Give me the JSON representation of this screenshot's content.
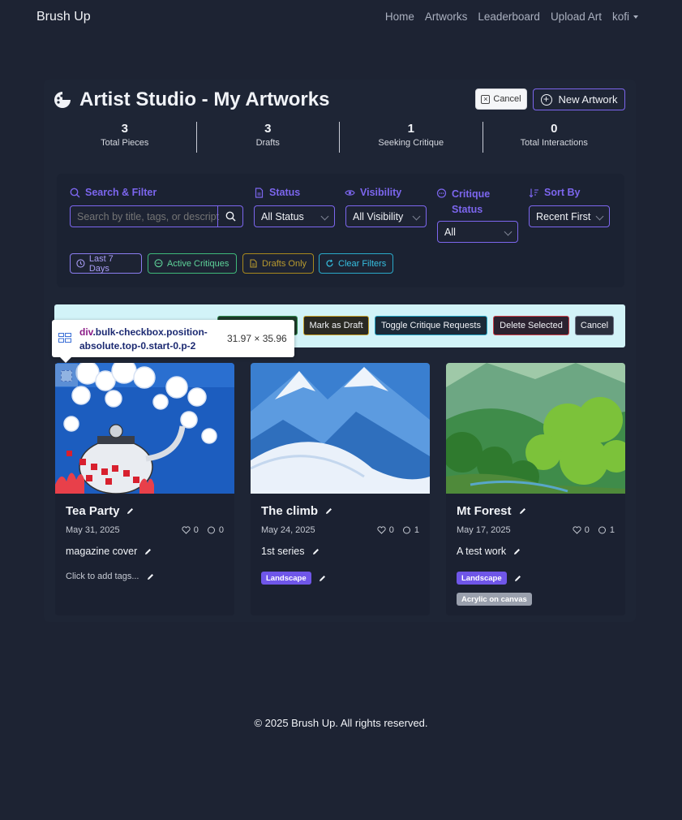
{
  "nav": {
    "brand": "Brush Up",
    "links": [
      "Home",
      "Artworks",
      "Leaderboard",
      "Upload Art",
      "kofi"
    ]
  },
  "header": {
    "title": "Artist Studio - My Artworks",
    "cancel_label": "Cancel",
    "new_label": "New Artwork"
  },
  "stats": [
    {
      "value": "3",
      "label": "Total Pieces"
    },
    {
      "value": "3",
      "label": "Drafts"
    },
    {
      "value": "1",
      "label": "Seeking Critique"
    },
    {
      "value": "0",
      "label": "Total Interactions"
    }
  ],
  "filters": {
    "search_label": "Search & Filter",
    "search_placeholder": "Search by title, tags, or description...",
    "status_label": "Status",
    "status_value": "All Status",
    "visibility_label": "Visibility",
    "visibility_value": "All Visibility",
    "critique_label_1": "Critique",
    "critique_label_2": "Status",
    "critique_value": "All",
    "sort_label": "Sort By",
    "sort_value": "Recent First",
    "chips": [
      "Last 7 Days",
      "Active Critiques",
      "Drafts Only",
      "Clear Filters"
    ]
  },
  "bulk": {
    "buttons": [
      "Mark as Draft",
      "Toggle Critique Requests",
      "Delete Selected",
      "Cancel"
    ]
  },
  "tooltip": {
    "tag": "div",
    "selector": ".bulk-checkbox.position-absolute.top-0.start-0.p-2",
    "dims": "31.97 × 35.96"
  },
  "artworks": [
    {
      "title": "Tea Party",
      "date": "May 31, 2025",
      "likes": "0",
      "comments": "0",
      "description": "magazine cover",
      "tags_placeholder": "Click to add tags...",
      "tags": []
    },
    {
      "title": "The climb",
      "date": "May 24, 2025",
      "likes": "0",
      "comments": "1",
      "description": "1st series",
      "tags": [
        "Landscape"
      ]
    },
    {
      "title": "Mt Forest",
      "date": "May 17, 2025",
      "likes": "0",
      "comments": "1",
      "description": "A test work",
      "tags": [
        "Landscape"
      ],
      "medium": "Acrylic on canvas"
    }
  ],
  "footer": "© 2025 Brush Up. All rights reserved.",
  "colors": {
    "background": "#1d2333",
    "accent": "#7c66ee",
    "bulk_bar": "#d2f3f8"
  }
}
